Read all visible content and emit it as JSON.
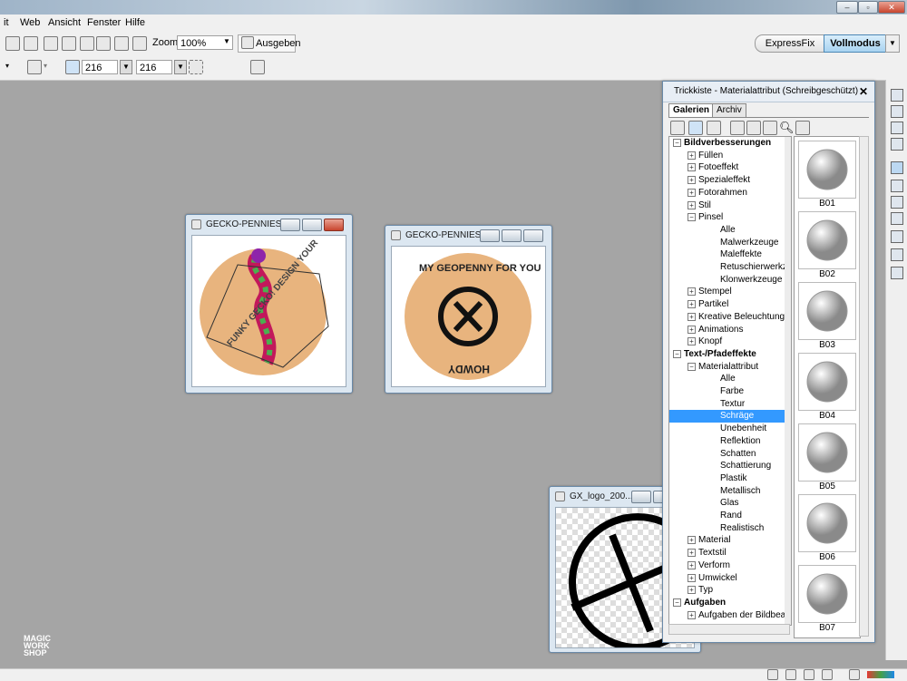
{
  "menubar": {
    "items": [
      "it",
      "Web",
      "Ansicht",
      "Fenster",
      "Hilfe"
    ]
  },
  "toolbar": {
    "zoom_label": "Zoom",
    "zoom_value": "100%",
    "output_label": "Ausgeben"
  },
  "toolbar2": {
    "width_value": "216",
    "height_value": "216"
  },
  "mode": {
    "expressfix": "ExpressFix",
    "vollmodus": "Vollmodus"
  },
  "documents": [
    {
      "title": "GECKO-PENNIES...",
      "text_top": "FUNKY GECKO! DESIGN YOUR"
    },
    {
      "title": "GECKO-PENNIES...",
      "text_top": "MY GEOPENNY FOR YOU",
      "text_bottom": "HOWDY"
    },
    {
      "title": "GX_logo_200...."
    }
  ],
  "trickkiste": {
    "title": "Trickkiste - Materialattribut (Schreibgeschützt)",
    "tabs": [
      "Galerien",
      "Archiv"
    ],
    "tree": [
      {
        "label": "Bildverbesserungen",
        "level": 0,
        "toggle": "−",
        "bold": true
      },
      {
        "label": "Füllen",
        "level": 1,
        "toggle": "+"
      },
      {
        "label": "Fotoeffekt",
        "level": 1,
        "toggle": "+"
      },
      {
        "label": "Spezialeffekt",
        "level": 1,
        "toggle": "+"
      },
      {
        "label": "Fotorahmen",
        "level": 1,
        "toggle": "+"
      },
      {
        "label": "Stil",
        "level": 1,
        "toggle": "+"
      },
      {
        "label": "Pinsel",
        "level": 1,
        "toggle": "−"
      },
      {
        "label": "Alle",
        "level": 2
      },
      {
        "label": "Malwerkzeuge",
        "level": 2
      },
      {
        "label": "Maleffekte",
        "level": 2
      },
      {
        "label": "Retuschierwerkzeuge",
        "level": 2
      },
      {
        "label": "Klonwerkzeuge",
        "level": 2
      },
      {
        "label": "Stempel",
        "level": 1,
        "toggle": "+"
      },
      {
        "label": "Partikel",
        "level": 1,
        "toggle": "+"
      },
      {
        "label": "Kreative Beleuchtungs",
        "level": 1,
        "toggle": "+"
      },
      {
        "label": "Animations",
        "level": 1,
        "toggle": "+"
      },
      {
        "label": "Knopf",
        "level": 1,
        "toggle": "+"
      },
      {
        "label": "Text-/Pfadeffekte",
        "level": 0,
        "toggle": "−",
        "bold": true
      },
      {
        "label": "Materialattribut",
        "level": 1,
        "toggle": "−"
      },
      {
        "label": "Alle",
        "level": 2
      },
      {
        "label": "Farbe",
        "level": 2
      },
      {
        "label": "Textur",
        "level": 2
      },
      {
        "label": "Schräge",
        "level": 2,
        "selected": true
      },
      {
        "label": "Unebenheit",
        "level": 2
      },
      {
        "label": "Reflektion",
        "level": 2
      },
      {
        "label": "Schatten",
        "level": 2
      },
      {
        "label": "Schattierung",
        "level": 2
      },
      {
        "label": "Plastik",
        "level": 2
      },
      {
        "label": "Metallisch",
        "level": 2
      },
      {
        "label": "Glas",
        "level": 2
      },
      {
        "label": "Rand",
        "level": 2
      },
      {
        "label": "Realistisch",
        "level": 2
      },
      {
        "label": "Material",
        "level": 1,
        "toggle": "+"
      },
      {
        "label": "Textstil",
        "level": 1,
        "toggle": "+"
      },
      {
        "label": "Verform",
        "level": 1,
        "toggle": "+"
      },
      {
        "label": "Umwickel",
        "level": 1,
        "toggle": "+"
      },
      {
        "label": "Typ",
        "level": 1,
        "toggle": "+"
      },
      {
        "label": "Aufgaben",
        "level": 0,
        "toggle": "−",
        "bold": true
      },
      {
        "label": "Aufgaben der Bildbear",
        "level": 1,
        "toggle": "+"
      }
    ],
    "thumbs": [
      "B01",
      "B02",
      "B03",
      "B04",
      "B05",
      "B06",
      "B07"
    ]
  },
  "logo": {
    "lines": [
      "MAGIC",
      "WORK",
      "SHOP"
    ]
  },
  "colors": {
    "selection": "#3399ff",
    "accent": "#a8d3f1",
    "workspace": "#a5a5a5"
  }
}
